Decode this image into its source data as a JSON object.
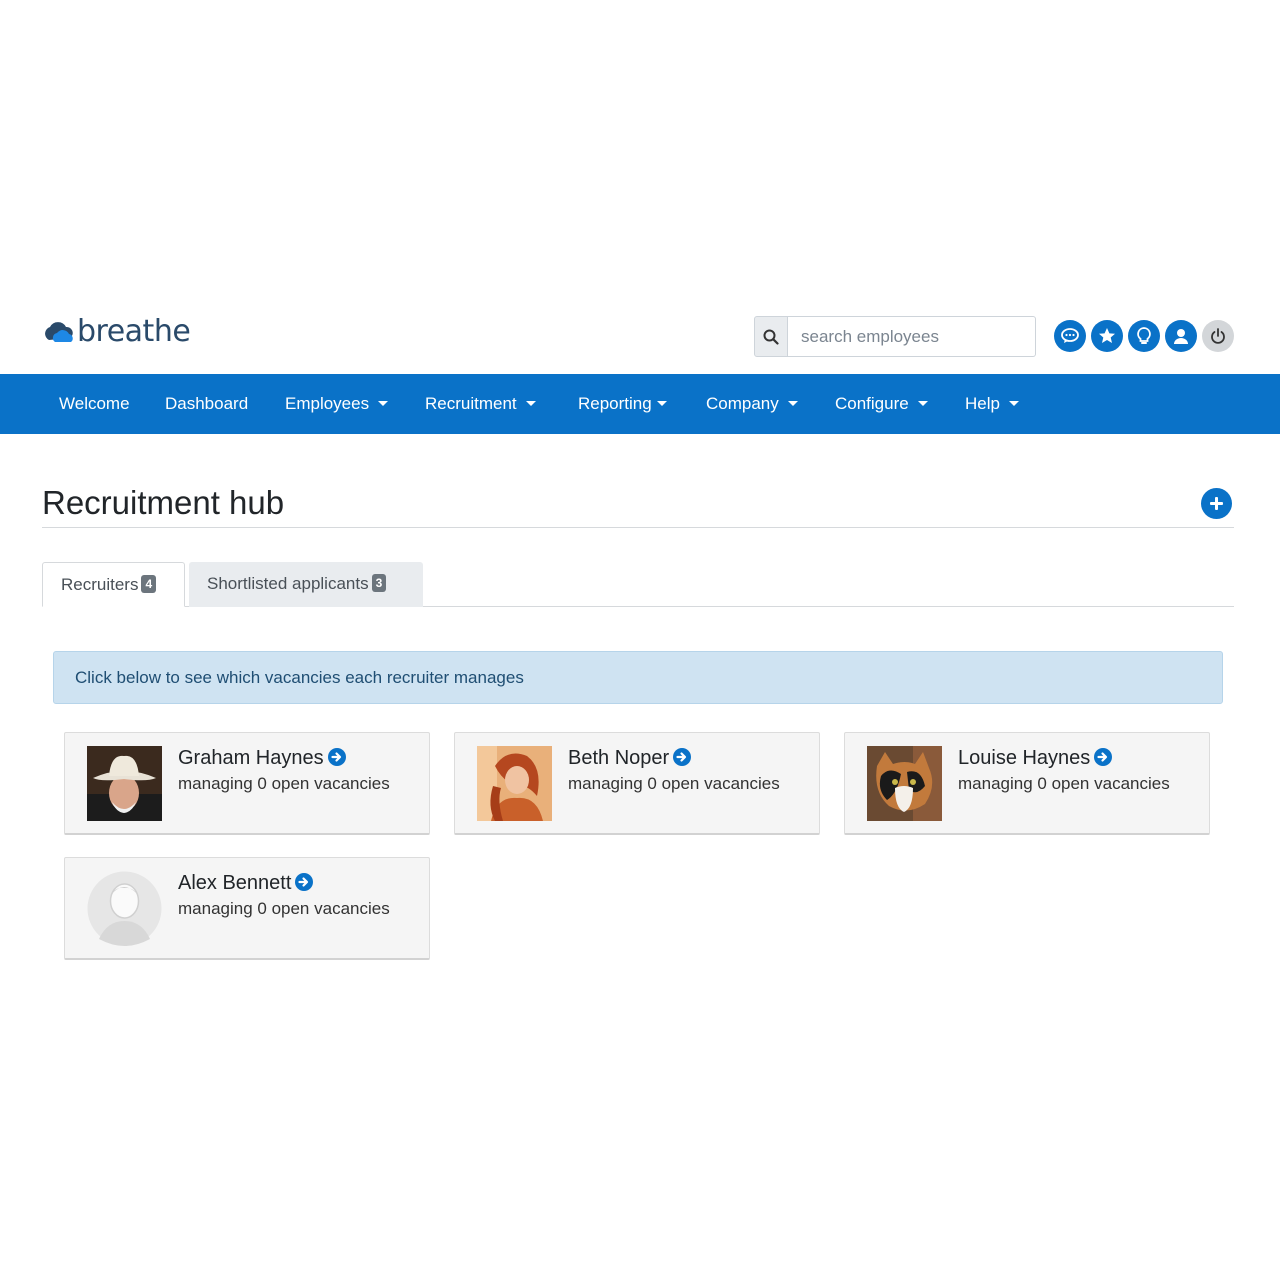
{
  "app": {
    "logo_text": "breathe"
  },
  "search": {
    "placeholder": "search employees"
  },
  "top_icons": [
    "chat-icon",
    "star-icon",
    "lightbulb-icon",
    "user-icon",
    "power-icon"
  ],
  "nav": {
    "items": [
      {
        "label": "Welcome",
        "dropdown": false
      },
      {
        "label": "Dashboard",
        "dropdown": false
      },
      {
        "label": "Employees",
        "dropdown": true
      },
      {
        "label": "Recruitment",
        "dropdown": true
      },
      {
        "label": "Reporting",
        "dropdown": true
      },
      {
        "label": "Company",
        "dropdown": true
      },
      {
        "label": "Configure",
        "dropdown": true
      },
      {
        "label": "Help",
        "dropdown": true
      }
    ]
  },
  "page": {
    "title": "Recruitment hub"
  },
  "tabs": [
    {
      "label": "Recruiters",
      "count": "4",
      "active": true
    },
    {
      "label": "Shortlisted applicants",
      "count": "3",
      "active": false
    }
  ],
  "alert": {
    "text": "Click below to see which vacancies each recruiter manages"
  },
  "recruiters": [
    {
      "name": "Graham Haynes",
      "subtitle": "managing 0 open vacancies"
    },
    {
      "name": "Beth Noper",
      "subtitle": "managing 0 open vacancies"
    },
    {
      "name": "Louise Haynes",
      "subtitle": "managing 0 open vacancies"
    },
    {
      "name": "Alex Bennett",
      "subtitle": "managing 0 open vacancies"
    }
  ],
  "colors": {
    "brand_blue": "#0a72c8",
    "alert_bg": "#cfe3f2",
    "card_bg": "#f5f5f5"
  }
}
